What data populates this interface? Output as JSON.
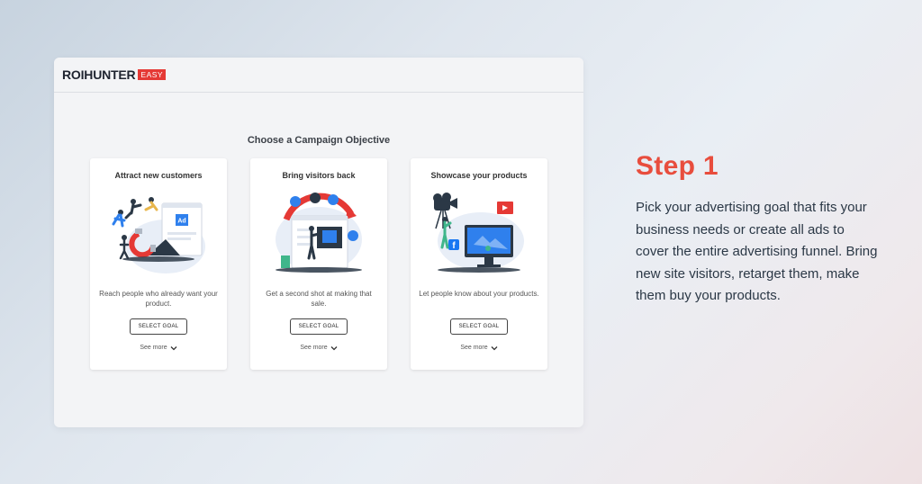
{
  "app": {
    "logo_text": "ROIHUNTER",
    "logo_badge": "EASY",
    "page_title": "Choose a Campaign Objective"
  },
  "cards": [
    {
      "title": "Attract new customers",
      "illustration": "magnet-ad-illustration",
      "description": "Reach people who already want your product.",
      "button_label": "SELECT GOAL",
      "see_more_label": "See more"
    },
    {
      "title": "Bring visitors back",
      "illustration": "retarget-cycle-illustration",
      "description": "Get a second shot at making that sale.",
      "button_label": "SELECT GOAL",
      "see_more_label": "See more"
    },
    {
      "title": "Showcase your products",
      "illustration": "camera-video-facebook-illustration",
      "description": "Let people know about your products.",
      "button_label": "SELECT GOAL",
      "see_more_label": "See more"
    }
  ],
  "promo": {
    "heading": "Step 1",
    "body": "Pick your advertising goal that fits your business needs or create all ads to cover the entire advertising funnel. Bring new site visitors, retarget them, make them buy your products."
  },
  "colors": {
    "accent": "#e84d3d",
    "brand_red": "#e53935",
    "illustration_blue": "#2f80ed",
    "text_dark": "#2b3846"
  }
}
